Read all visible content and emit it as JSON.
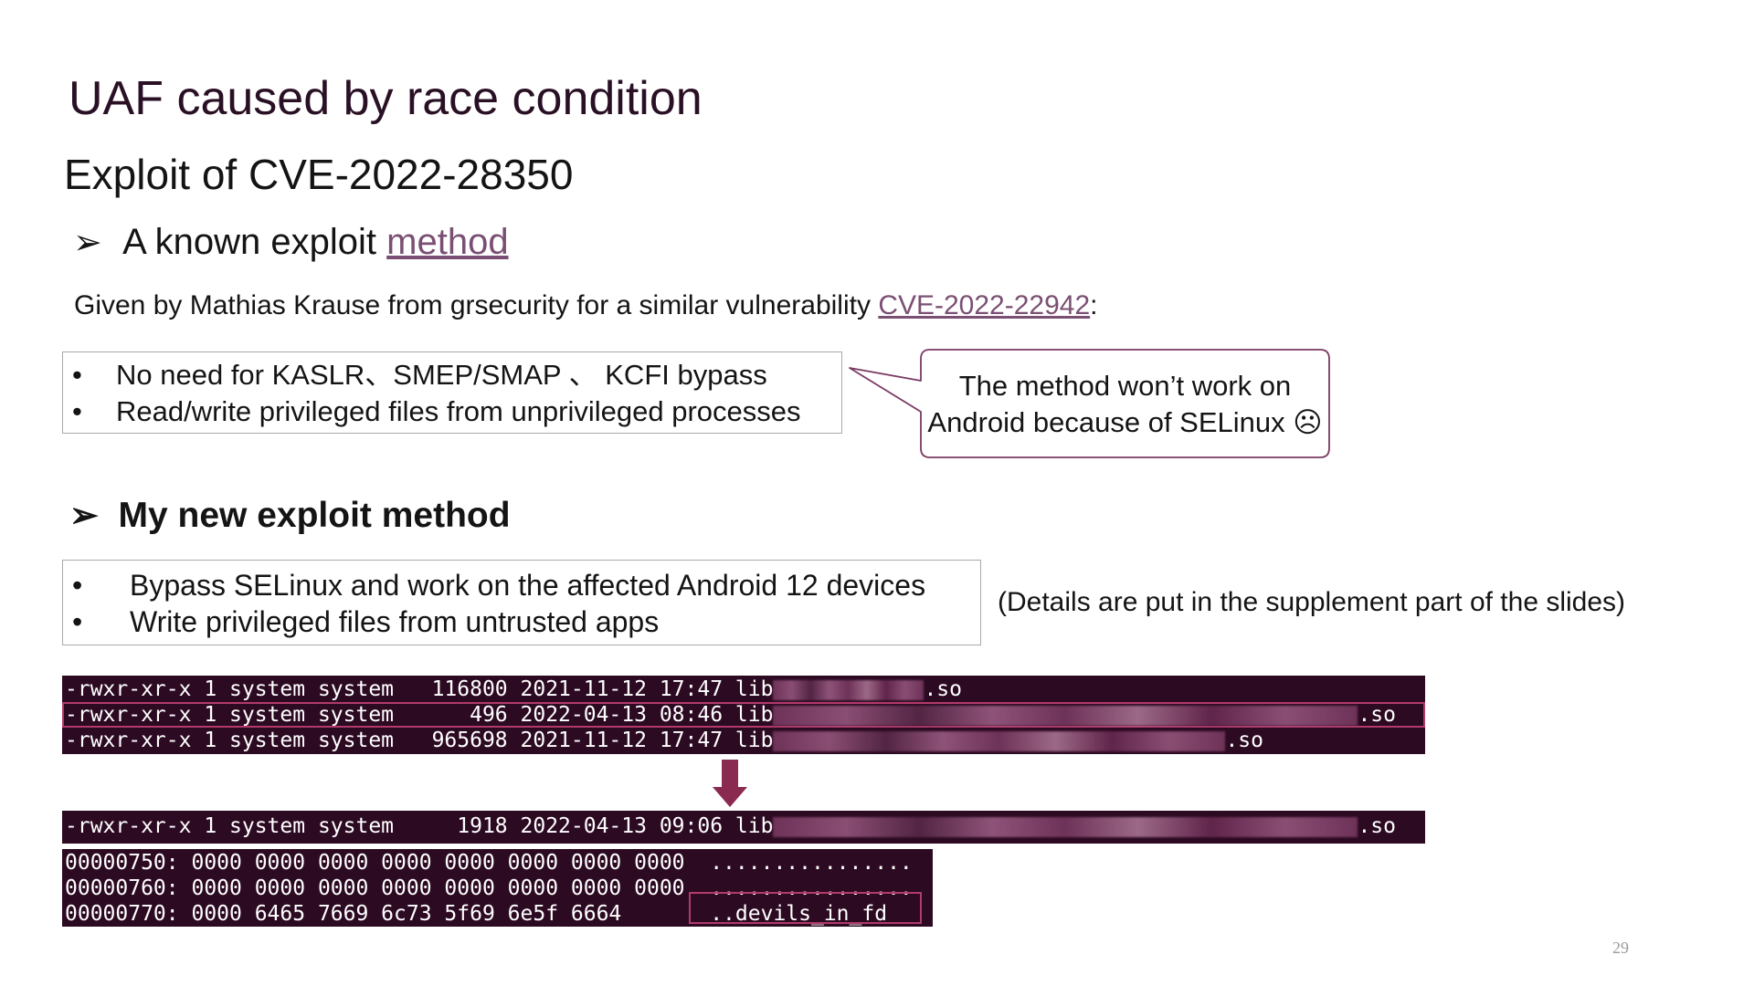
{
  "slide": {
    "title": "UAF caused by race condition",
    "subtitle": "Exploit of  CVE-2022-28350",
    "known_section": {
      "arrow": "➢",
      "heading_prefix": "A known exploit ",
      "heading_link": "method"
    },
    "given_by": {
      "text": "Given by Mathias Krause from grsecurity for a similar vulnerability ",
      "link": "CVE-2022-22942",
      "suffix": ":"
    },
    "known_bullets": [
      "No need for KASLR、SMEP/SMAP 、 KCFI bypass",
      "Read/write privileged files from unprivileged processes"
    ],
    "callout": {
      "line1": "The method won’t work on",
      "line2": "Android because of SELinux ☹"
    },
    "new_section": {
      "arrow": "➢",
      "heading": "My new exploit method"
    },
    "new_bullets": [
      "Bypass SELinux and work on the affected Android 12 devices",
      "Write privileged files from untrusted apps"
    ],
    "bullet_char": "•",
    "details_note": "(Details are put in the supplement part of the slides)",
    "terminal_before": [
      {
        "perm": "-rwxr-xr-x 1 system system   116800 2021-11-12 17:47 lib",
        "suffix": ".so"
      },
      {
        "perm": "-rwxr-xr-x 1 system system      496 2022-04-13 08:46 lib",
        "suffix": ".so"
      },
      {
        "perm": "-rwxr-xr-x 1 system system   965698 2021-11-12 17:47 lib",
        "suffix": ".so"
      }
    ],
    "terminal_after": {
      "perm": "-rwxr-xr-x 1 system system     1918 2022-04-13 09:06 lib",
      "suffix": ".so"
    },
    "hexdump": [
      "00000750: 0000 0000 0000 0000 0000 0000 0000 0000  ................",
      "00000760: 0000 0000 0000 0000 0000 0000 0000 0000  ................",
      "00000770: 0000 6465 7669 6c73 5f69 6e5f 6664       ..devils_in_fd"
    ],
    "page_number": "29",
    "colors": {
      "terminal_bg": "#2c0a22",
      "highlight": "#b23a6a",
      "link": "#7a4f73",
      "arrow": "#8a2a50"
    }
  }
}
